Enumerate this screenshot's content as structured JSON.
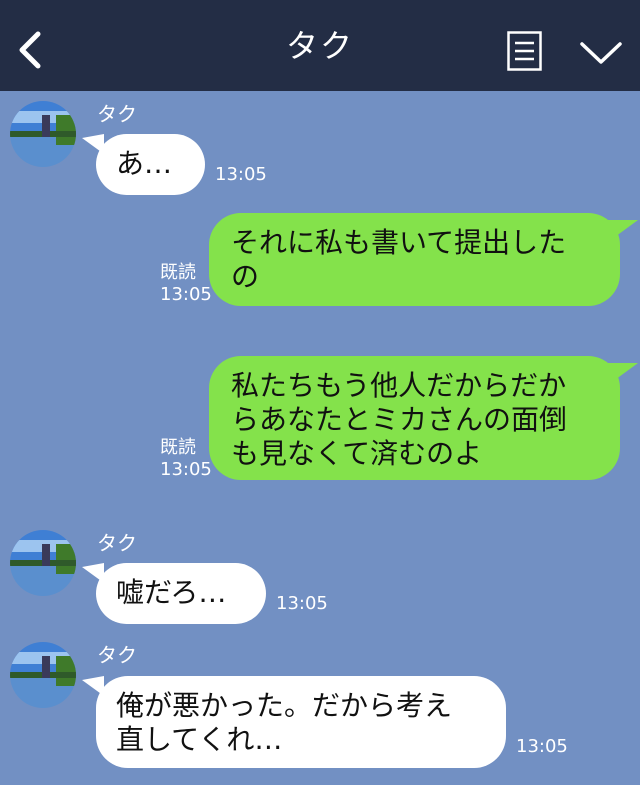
{
  "header": {
    "title": "タク",
    "back_icon": "chevron-left-icon",
    "menu_icon": "memo-icon",
    "dropdown_icon": "chevron-down-icon",
    "background": "#232d45"
  },
  "chat": {
    "background": "#7290c3",
    "incoming_bubble_color": "#ffffff",
    "outgoing_bubble_color": "#84e24b",
    "messages": [
      {
        "from": "タク",
        "text": "あ…",
        "time": "13:05"
      },
      {
        "from": "me",
        "text": "それに私も書いて提出した\nの",
        "read": "既読",
        "time": "13:05"
      },
      {
        "from": "me",
        "text": "私たちもう他人だからだか\nらあなたとミカさんの面倒\nも見なくて済むのよ",
        "read": "既読",
        "time": "13:05"
      },
      {
        "from": "タク",
        "text": "嘘だろ…",
        "time": "13:05"
      },
      {
        "from": "タク",
        "text": "俺が悪かった。だから考え\n直してくれ…",
        "time": "13:05"
      }
    ]
  }
}
